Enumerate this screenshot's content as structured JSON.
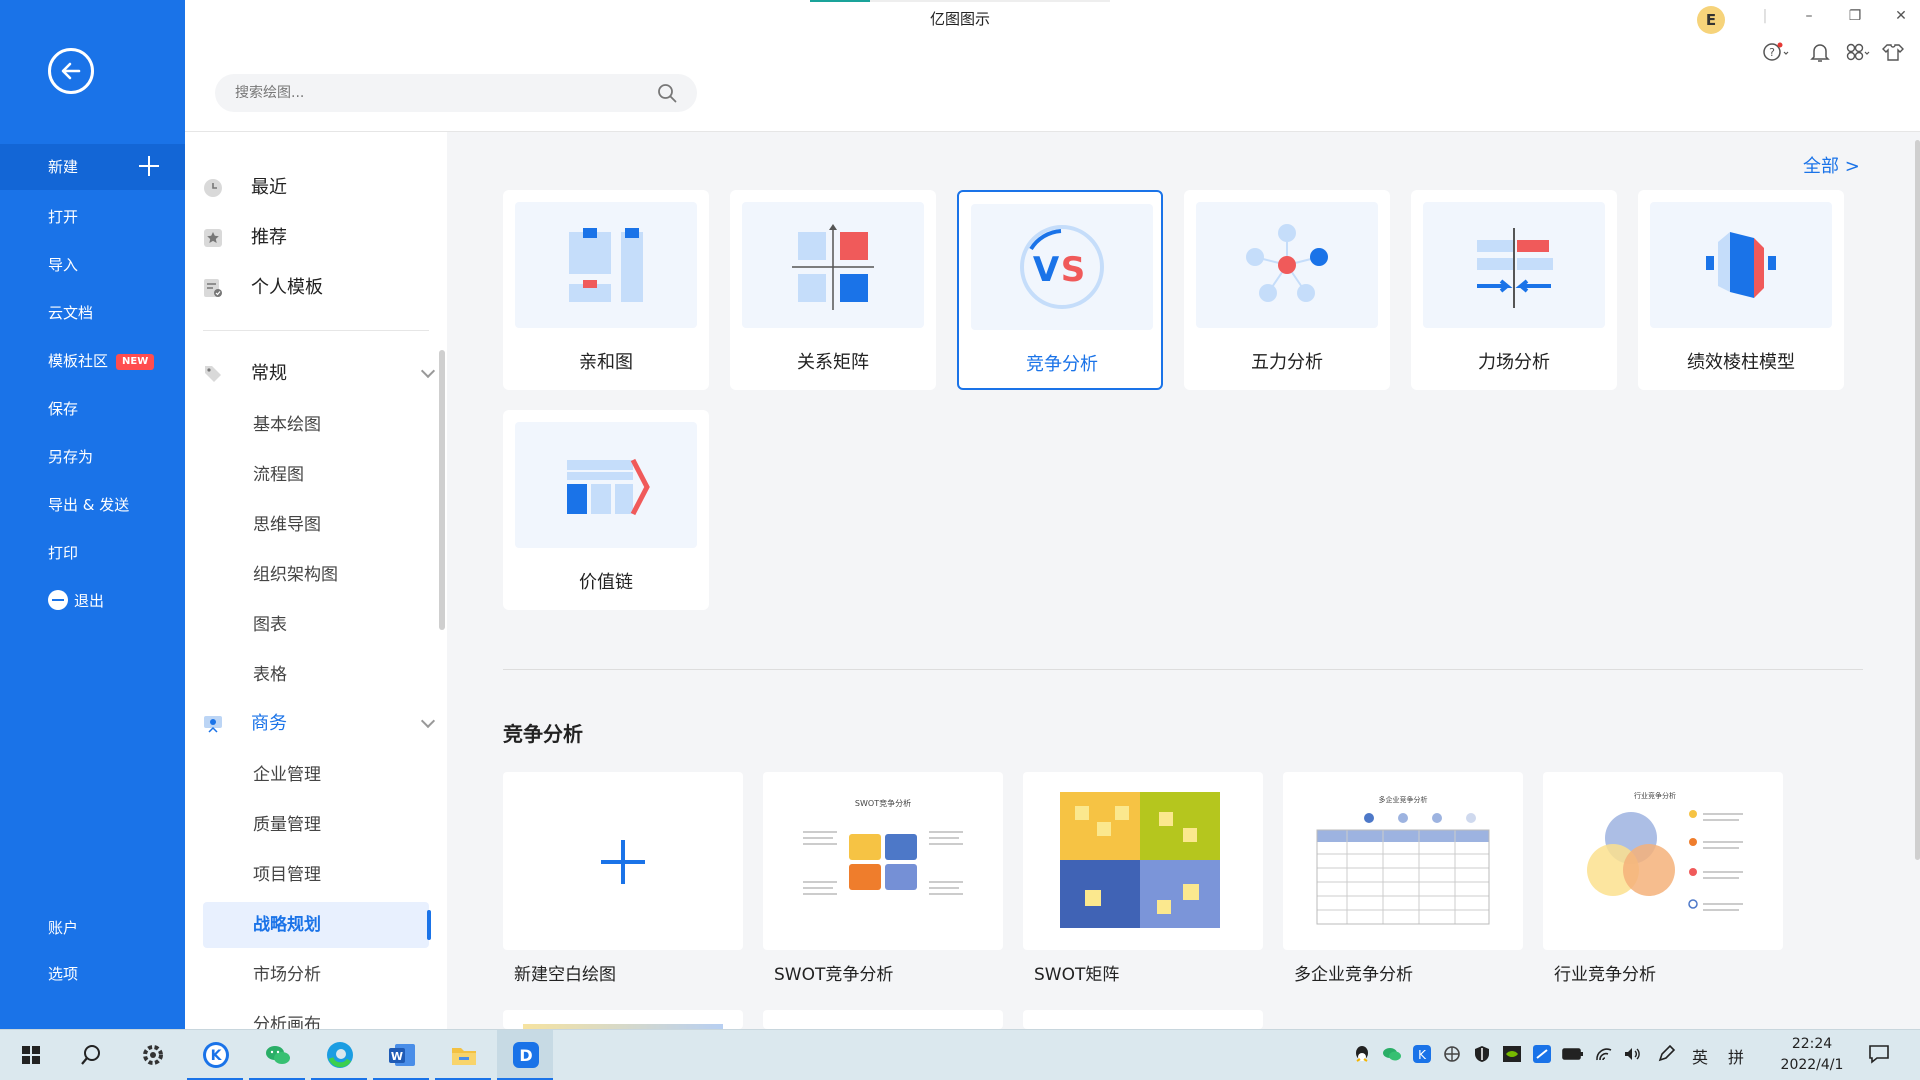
{
  "window": {
    "title": "亿图图示",
    "user_initial": "E",
    "minimize": "–",
    "restore": "❐",
    "close": "✕"
  },
  "search": {
    "placeholder": "搜索绘图..."
  },
  "sidebar": {
    "new_label": "新建",
    "items": [
      "打开",
      "导入",
      "云文档",
      "模板社区",
      "保存",
      "另存为",
      "导出 & 发送",
      "打印",
      "退出"
    ],
    "new_badge": "NEW",
    "bottom": [
      "账户",
      "选项"
    ]
  },
  "categories": {
    "top": [
      "最近",
      "推荐",
      "个人模板"
    ],
    "general": {
      "label": "常规",
      "items": [
        "基本绘图",
        "流程图",
        "思维导图",
        "组织架构图",
        "图表",
        "表格"
      ]
    },
    "business": {
      "label": "商务",
      "items": [
        "企业管理",
        "质量管理",
        "项目管理",
        "战略规划",
        "市场分析",
        "分析画布"
      ]
    }
  },
  "main": {
    "all_label": "全部 >",
    "templates": [
      "亲和图",
      "关系矩阵",
      "竞争分析",
      "五力分析",
      "力场分析",
      "绩效棱柱模型",
      "价值链"
    ],
    "section_title": "竞争分析",
    "examples": [
      "新建空白绘图",
      "SWOT竞争分析",
      "SWOT矩阵",
      "多企业竞争分析",
      "行业竞争分析"
    ],
    "swot_title": "SWOT竞争分析",
    "multi_title": "多企业竞争分析",
    "industry_title": "行业竞争分析"
  },
  "taskbar": {
    "ime": "英",
    "ime2": "拼",
    "time": "22:24",
    "date": "2022/4/1"
  },
  "colors": {
    "accent": "#1a73e8",
    "sidebar": "#1a73e8",
    "badge": "#ff4d4f"
  }
}
